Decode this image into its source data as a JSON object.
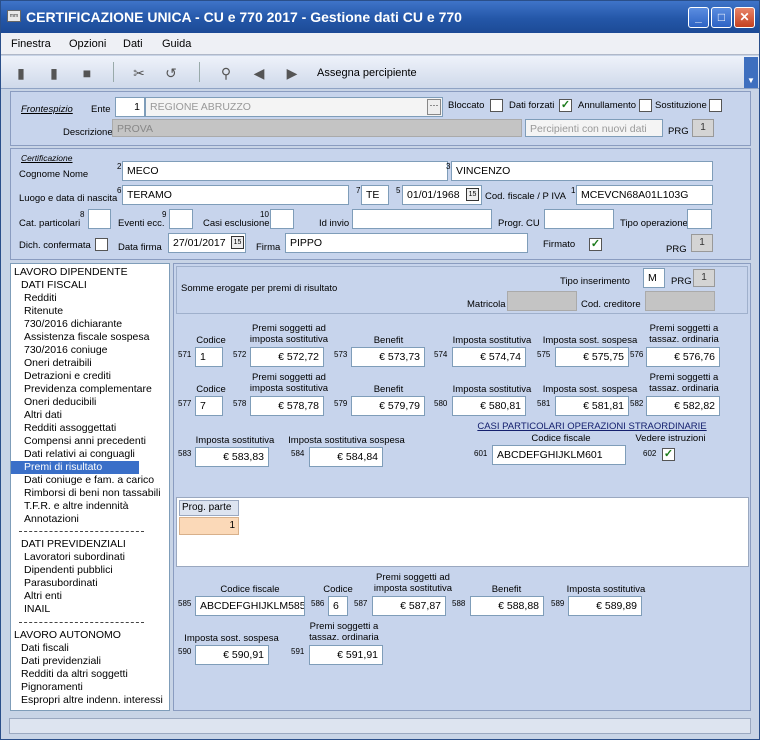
{
  "window": {
    "title": "CERTIFICAZIONE UNICA - CU e 770 2017 - Gestione dati CU e 770",
    "icon": "app-icon",
    "icon_text": "mm"
  },
  "menu": [
    "Finestra",
    "Opzioni",
    "Dati",
    "Guida"
  ],
  "toolbar": {
    "assign_label": "Assegna percipiente"
  },
  "frontespizio": {
    "link": "Frontespizio",
    "ente_label": "Ente",
    "ente_code": "1",
    "ente_name": "REGIONE ABRUZZO",
    "bloccato": "Bloccato",
    "dati_forzati": "Dati forzati",
    "annullamento": "Annullamento",
    "sostituzione": "Sostituzione",
    "descrizione_label": "Descrizione",
    "descrizione": "PROVA",
    "percipienti_placeholder": "Percipienti con nuovi dati",
    "prg_label": "PRG",
    "prg": "1"
  },
  "certificazione": {
    "link": "Certificazione",
    "cognome_label": "Cognome Nome",
    "sup2": "2",
    "cognome": "MECO",
    "sup3": "3",
    "nome": "VINCENZO",
    "luogo_label": "Luogo e data di nascita",
    "sup6": "6",
    "luogo": "TERAMO",
    "sup7": "7",
    "prov": "TE",
    "sup5": "5",
    "data_nascita": "01/01/1968",
    "cf_label": "Cod. fiscale / P IVA",
    "sup1": "1",
    "cf": "MCEVCN68A01L103G",
    "cat_label": "Cat. particolari",
    "sup8": "8",
    "eventi_label": "Eventi ecc.",
    "sup9": "9",
    "casi_label": "Casi esclusione",
    "sup10": "10",
    "idinvio_label": "Id invio",
    "progr_label": "Progr. CU",
    "tipo_op_label": "Tipo operazione",
    "dich_label": "Dich. confermata",
    "data_firma_label": "Data firma",
    "data_firma": "27/01/2017",
    "firma_label": "Firma",
    "firma": "PIPPO",
    "firmato_label": "Firmato",
    "prg_label": "PRG",
    "prg": "1"
  },
  "sidebar": {
    "sections": [
      {
        "title": "LAVORO DIPENDENTE"
      },
      {
        "title": "DATI FISCALI"
      }
    ],
    "items_fiscali": [
      "Redditi",
      "Ritenute",
      "730/2016 dichiarante",
      "Assistenza fiscale sospesa",
      "730/2016 coniuge",
      "Oneri detraibili",
      "Detrazioni e crediti",
      "Previdenza complementare",
      "Oneri deducibili",
      "Altri dati",
      "Redditi assoggettati",
      "Compensi anni precedenti",
      "Dati relativi ai conguagli",
      "Premi di risultato",
      "Dati coniuge e fam. a carico",
      "Rimborsi di beni non tassabili",
      "T.F.R. e altre indennità",
      "Annotazioni"
    ],
    "dati_prev_title": "DATI PREVIDENZIALI",
    "items_prev": [
      "Lavoratori subordinati",
      "Dipendenti pubblici",
      "Parasubordinati",
      "Altri enti",
      "INAIL"
    ],
    "autonomo_title": "LAVORO AUTONOMO",
    "items_auto": [
      "Dati fiscali",
      "Dati previdenziali",
      "Redditi da altri soggetti",
      "Pignoramenti",
      "Espropri altre indenn. interessi"
    ]
  },
  "main": {
    "header": {
      "title": "Somme erogate per premi di risultato",
      "tipo_label": "Tipo inserimento",
      "tipo": "M",
      "prg_label": "PRG",
      "prg": "1",
      "matricola_label": "Matricola",
      "cod_cred_label": "Cod. creditore"
    },
    "col_codice": "Codice",
    "col_premi": "Premi soggetti ad imposta sostitutiva",
    "col_benefit": "Benefit",
    "col_imposta": "Imposta sostitutiva",
    "col_sospesa": "Imposta sost. sospesa",
    "col_ordinaria": "Premi soggetti a tassaz. ordinaria",
    "row1": {
      "n571": "571",
      "v571": "1",
      "n572": "572",
      "v572": "€ 572,72",
      "n573": "573",
      "v573": "€ 573,73",
      "n574": "574",
      "v574": "€ 574,74",
      "n575": "575",
      "v575": "€ 575,75",
      "n576": "576",
      "v576": "€ 576,76"
    },
    "row2": {
      "n577": "577",
      "v577": "7",
      "n578": "578",
      "v578": "€ 578,78",
      "n579": "579",
      "v579": "€ 579,79",
      "n580": "580",
      "v580": "€ 580,81",
      "n581": "581",
      "v581": "€ 581,81",
      "n582": "582",
      "v582": "€ 582,82"
    },
    "row3": {
      "lbl_imp": "Imposta sostitutiva",
      "lbl_sosp": "Imposta sostitutiva sospesa",
      "n583": "583",
      "v583": "€ 583,83",
      "n584": "584",
      "v584": "€ 584,84"
    },
    "casi": {
      "title": "CASI PARTICOLARI OPERAZIONI STRAORDINARIE",
      "cf_label": "Codice fiscale",
      "vedere_label": "Vedere istruzioni",
      "n601": "601",
      "v601": "ABCDEFGHIJKLM601",
      "n602": "602"
    },
    "grid": {
      "header": "Prog. parte",
      "value": "1"
    },
    "bottom": {
      "cf_label": "Codice fiscale",
      "codice_label": "Codice",
      "premi_label": "Premi soggetti ad imposta sostitutiva",
      "benefit_label": "Benefit",
      "imposta_label": "Imposta sostitutiva",
      "n585": "585",
      "v585": "ABCDEFGHIJKLM585",
      "n586": "586",
      "v586": "6",
      "n587": "587",
      "v587": "€ 587,87",
      "n588": "588",
      "v588": "€ 588,88",
      "n589": "589",
      "v589": "€ 589,89",
      "sospesa_label": "Imposta sost. sospesa",
      "ordinaria_label": "Premi soggetti a tassaz. ordinaria",
      "n590": "590",
      "v590": "€ 590,91",
      "n591": "591",
      "v591": "€ 591,91"
    }
  }
}
